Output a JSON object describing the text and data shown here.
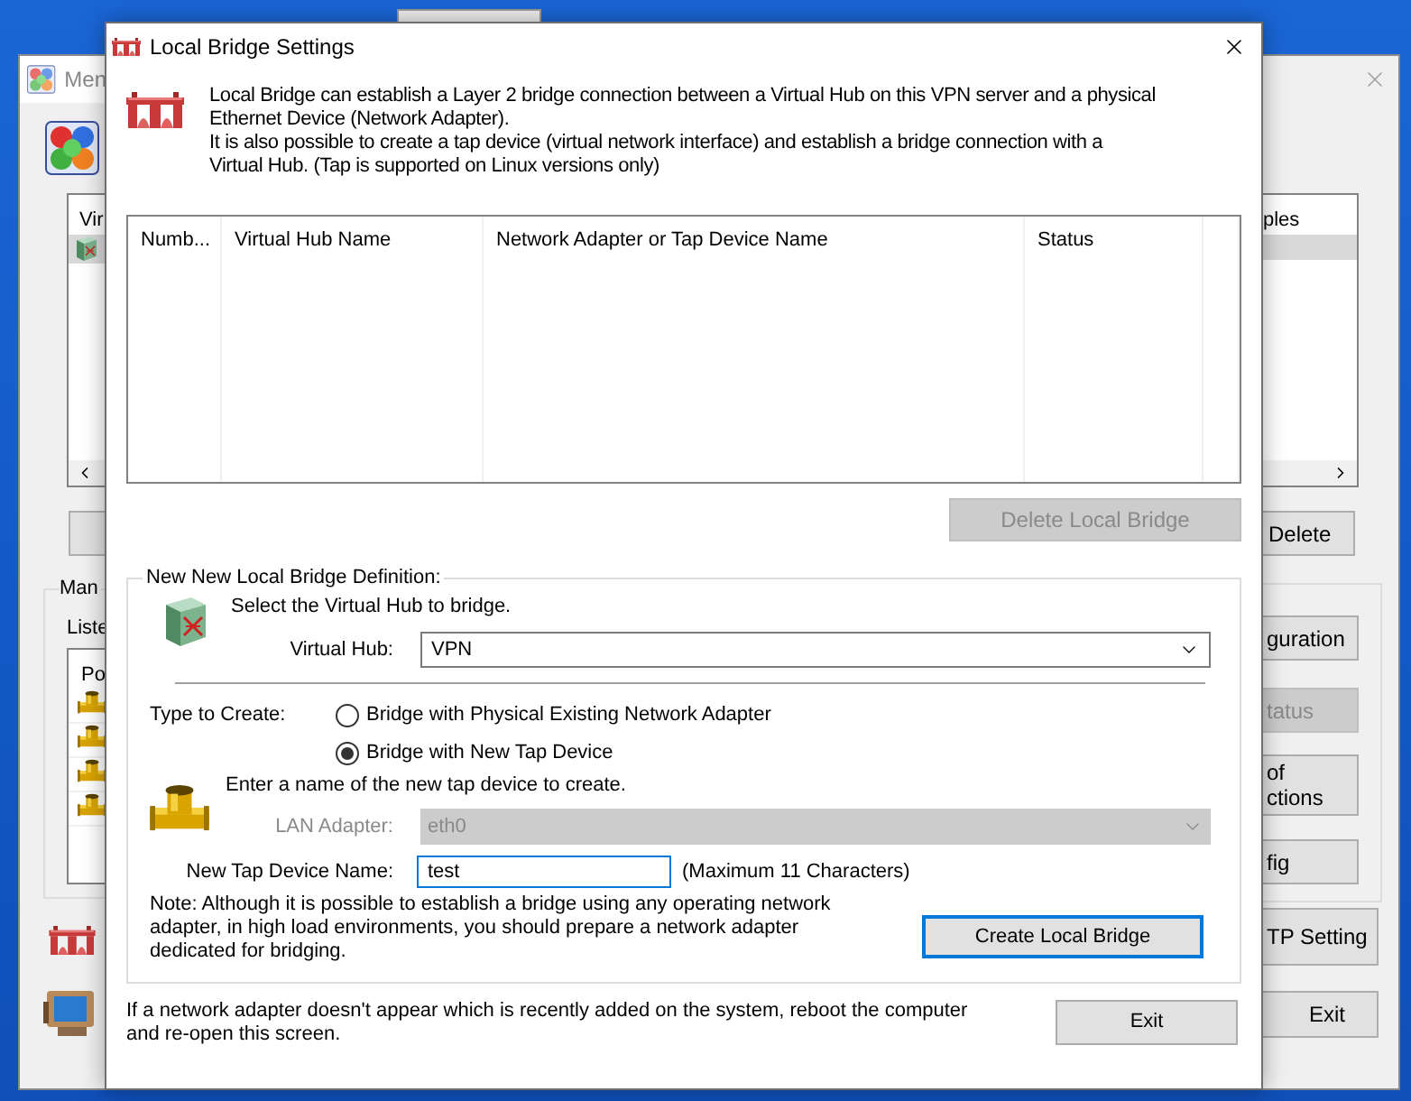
{
  "top_window": {
    "kind": "window-edge"
  },
  "background_window": {
    "title": "Men",
    "left": {
      "list_header": "Vir",
      "group_label": "Man",
      "list_label": "Liste",
      "list2_header": "Po"
    },
    "right": {
      "list_header": "ples",
      "list_button": {
        "label": "Delete",
        "disabled": false
      },
      "buttons": [
        {
          "label": "guration",
          "disabled": false
        },
        {
          "label": "tatus",
          "disabled": true
        },
        {
          "label": "of\nctions",
          "disabled": false
        },
        {
          "label": "fig",
          "disabled": false
        }
      ],
      "bottom_buttons": [
        {
          "label": "TP Setting",
          "disabled": false
        },
        {
          "label": "Exit",
          "disabled": false
        }
      ]
    }
  },
  "dialog": {
    "title": "Local Bridge Settings",
    "description": [
      "Local Bridge can establish a Layer 2 bridge connection between a Virtual Hub on this VPN server and a physical",
      "Ethernet Device (Network Adapter).",
      "It is also possible to create a tap device (virtual network interface) and establish a bridge connection with a",
      "Virtual Hub. (Tap is supported on Linux versions only)"
    ],
    "table": {
      "columns": [
        "Numb...",
        "Virtual Hub Name",
        "Network Adapter or Tap Device Name",
        "Status"
      ]
    },
    "delete_button": {
      "label": "Delete Local Bridge",
      "disabled": true
    },
    "definition": {
      "title": "New New Local Bridge Definition:",
      "hub_prompt": "Select the Virtual Hub to bridge.",
      "virtual_hub": {
        "label": "Virtual Hub:",
        "value": "VPN"
      },
      "type_label": "Type to Create:",
      "types": [
        {
          "label": "Bridge with Physical Existing Network Adapter",
          "selected": false
        },
        {
          "label": "Bridge with New Tap Device",
          "selected": true
        }
      ],
      "tap_prompt": "Enter a name of the new tap device to create.",
      "lan_adapter": {
        "label": "LAN Adapter:",
        "value": "eth0",
        "disabled": true
      },
      "tap_name": {
        "label": "New Tap Device Name:",
        "value": "test",
        "focused": true
      },
      "max_hint": "(Maximum 11 Characters)",
      "note": [
        "Note: Although it is possible to establish a bridge using any operating network",
        "adapter, in high load environments, you should prepare a network adapter",
        "dedicated for bridging."
      ],
      "create_button": {
        "label": "Create Local Bridge",
        "default": true
      }
    },
    "footer_note": [
      "If a network adapter doesn't appear which is recently added on the system, reboot the computer",
      "and re-open this screen."
    ],
    "exit_button": {
      "label": "Exit"
    }
  }
}
